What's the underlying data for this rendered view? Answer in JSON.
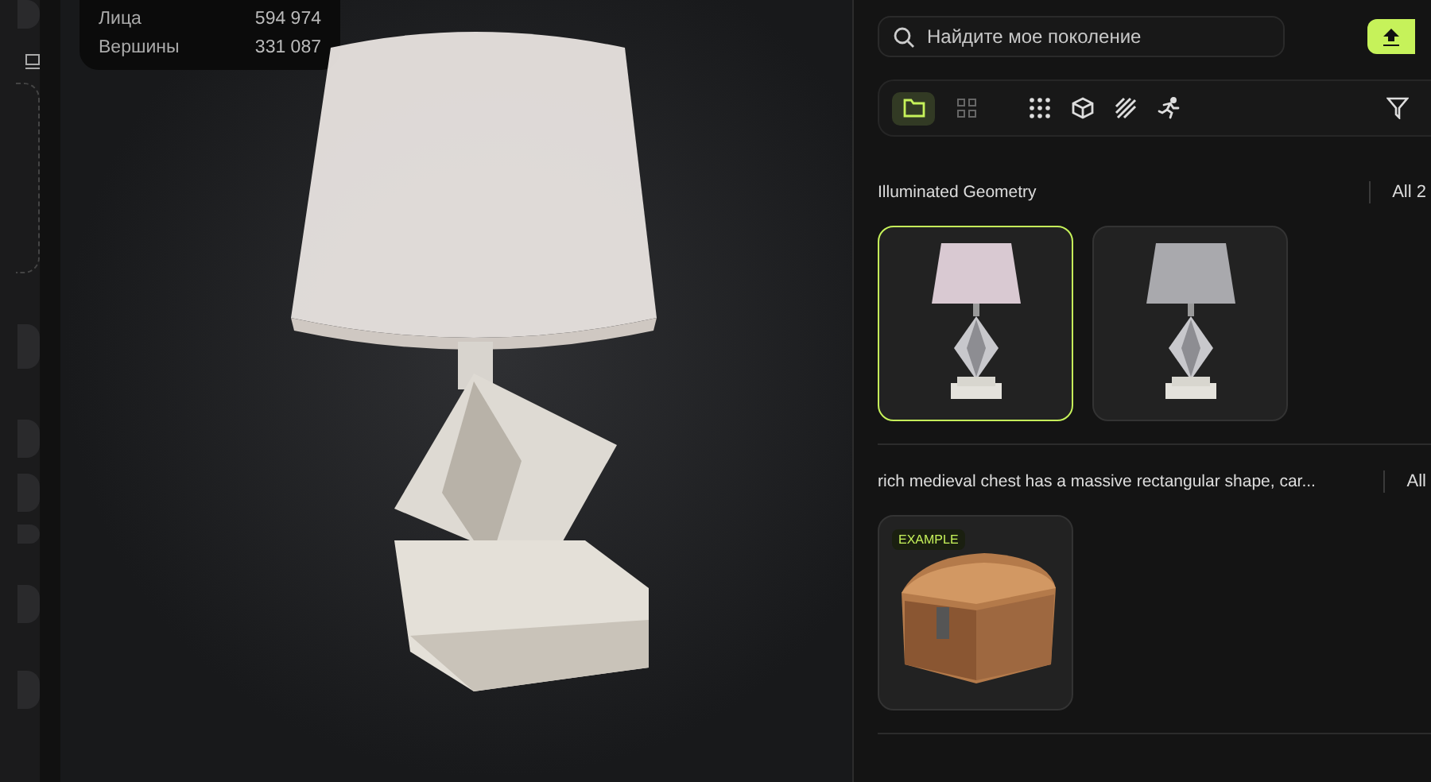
{
  "stats": [
    {
      "label": "Лица",
      "value": "594 974"
    },
    {
      "label": "Вершины",
      "value": "331 087"
    }
  ],
  "search": {
    "placeholder": "Найдите мое поколение"
  },
  "view_modes": [
    {
      "kind": "folder",
      "selected": true
    },
    {
      "kind": "grid",
      "selected": false
    }
  ],
  "filters": [
    {
      "kind": "dots"
    },
    {
      "kind": "cube"
    },
    {
      "kind": "hatch"
    },
    {
      "kind": "runner"
    }
  ],
  "sections": [
    {
      "title": "Illuminated Geometry",
      "all_label": "All 2",
      "items": [
        {
          "kind": "lamp",
          "selected": true
        },
        {
          "kind": "lamp-grey",
          "selected": false
        }
      ]
    },
    {
      "title": "rich medieval chest has a massive rectangular shape, car...",
      "all_label": "All",
      "items": [
        {
          "kind": "chest",
          "selected": false,
          "badge": "EXAMPLE"
        }
      ]
    }
  ]
}
